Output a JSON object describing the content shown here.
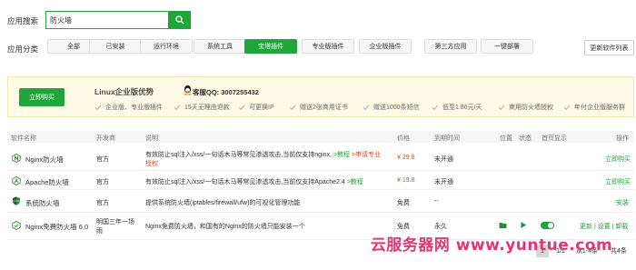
{
  "search": {
    "label": "应用搜索",
    "value": "防火墙"
  },
  "categories": {
    "label": "应用分类",
    "items": [
      "全部",
      "已安装",
      "运行环境",
      "系统工具",
      "宝塔插件",
      "专业版插件",
      "企业版插件",
      "第三方应用",
      "一键部署"
    ],
    "active_index": 4,
    "update_button": "更新软件列表"
  },
  "banner": {
    "buy_button": "立即购买",
    "title": "Linux企业版优势",
    "qq_label": "客服QQ: 3007255432",
    "features": [
      "企业版、专业版插件",
      "15天无理由退款",
      "可更换IP",
      "赠送2张商用证书",
      "赠送1000条短信",
      "低至1.86元/天",
      "商用防火墙授权",
      "年付企业版服务群"
    ]
  },
  "table": {
    "headers": [
      "软件名称",
      "开发商",
      "说明",
      "价格",
      "到期时间",
      "位置",
      "状态",
      "首页显示",
      "操作"
    ],
    "rows": [
      {
        "name": "Nginx防火墙",
        "developer": "官方",
        "desc_line1": "有效防止sql注入/xss/一句话木马等常见渗透攻击,当前仅支持nginx,",
        "desc_link": ">教程",
        "desc_red": ">申请专业",
        "desc_line2": "授权",
        "price": "¥ 29.8",
        "expire": "未开通",
        "action": "立即购买"
      },
      {
        "name": "Apache防火墙",
        "developer": "官方",
        "desc_line1": "有效防止sql注入/xss/一句话木马等常见渗透攻击,当前仅支持Apache2.4",
        "desc_link": ">教程",
        "price": "¥ 19.8",
        "expire": "未开通",
        "action": "立即购买"
      },
      {
        "name": "系统防火墙",
        "developer": "官方",
        "desc_line1": "提供系统防火墙(iptables/firewall/ufw)的可视化管理功能",
        "price": "免费",
        "expire": "--",
        "action": "安装"
      },
      {
        "name": "Nginx免费防火墙 6.0",
        "developer_line1": "明国三年一场",
        "developer_line2": "雨",
        "desc_line1": "Nginx免费防火墙，和国有的Nginx的防火墙只能安装一个",
        "price": "免费",
        "expire": "永久",
        "action": "更新 | 设置 | 卸载"
      }
    ]
  },
  "pagination": {
    "current": "1",
    "page_of": "1/1",
    "range": "从1-4条",
    "total": "共4条"
  },
  "watermark": "云服务器网 www.yuntue.com"
}
